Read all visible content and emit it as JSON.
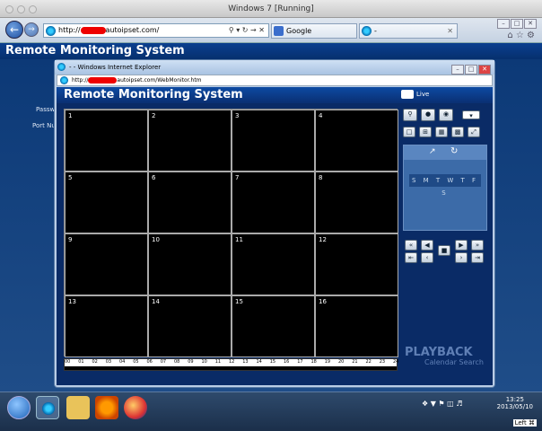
{
  "outer_window": {
    "title": "Windows 7 [Running]"
  },
  "outer_ie": {
    "address": "http://",
    "address_suffix": "autoipset.com/",
    "tab1": "Google",
    "tab2": "-"
  },
  "outer_page": {
    "title": "Remote Monitoring System",
    "side_labels": [
      "Passw",
      "Port Num"
    ]
  },
  "popup": {
    "title": "- - Windows Internet Explorer",
    "address": "http://",
    "address_suffix": "autoipset.com/WebMonitor.htm"
  },
  "inner": {
    "title": "Remote Monitoring System",
    "live_label": "Live",
    "cells": [
      "1",
      "2",
      "3",
      "4",
      "5",
      "6",
      "7",
      "8",
      "9",
      "10",
      "11",
      "12",
      "13",
      "14",
      "15",
      "16"
    ],
    "timeline_ticks": [
      "00",
      "01",
      "02",
      "03",
      "04",
      "05",
      "06",
      "07",
      "08",
      "09",
      "10",
      "11",
      "12",
      "13",
      "14",
      "15",
      "16",
      "17",
      "18",
      "19",
      "20",
      "21",
      "22",
      "23",
      "24"
    ],
    "calendar_days": "S M T W T F S",
    "playback_title": "PLAYBACK",
    "calendar_search": "Calendar Search"
  },
  "taskbar": {
    "time": "13:25",
    "date": "2013/05/10",
    "lang": "Left ⌘"
  },
  "icons": [
    "back-arrow-icon",
    "forward-arrow-icon",
    "ie-icon",
    "search-icon",
    "refresh-icon",
    "close-icon",
    "home-icon",
    "star-icon",
    "gear-icon",
    "camera-icon",
    "record-icon",
    "zoom-icon",
    "layout-1-icon",
    "layout-4-icon",
    "layout-9-icon",
    "layout-16-icon",
    "fullscreen-icon",
    "arrow-icon",
    "refresh-circle-icon",
    "rewind-icon",
    "play-icon",
    "stop-icon",
    "fast-forward-icon",
    "start-orb-icon",
    "explorer-icon",
    "media-icon",
    "firefox-icon"
  ]
}
